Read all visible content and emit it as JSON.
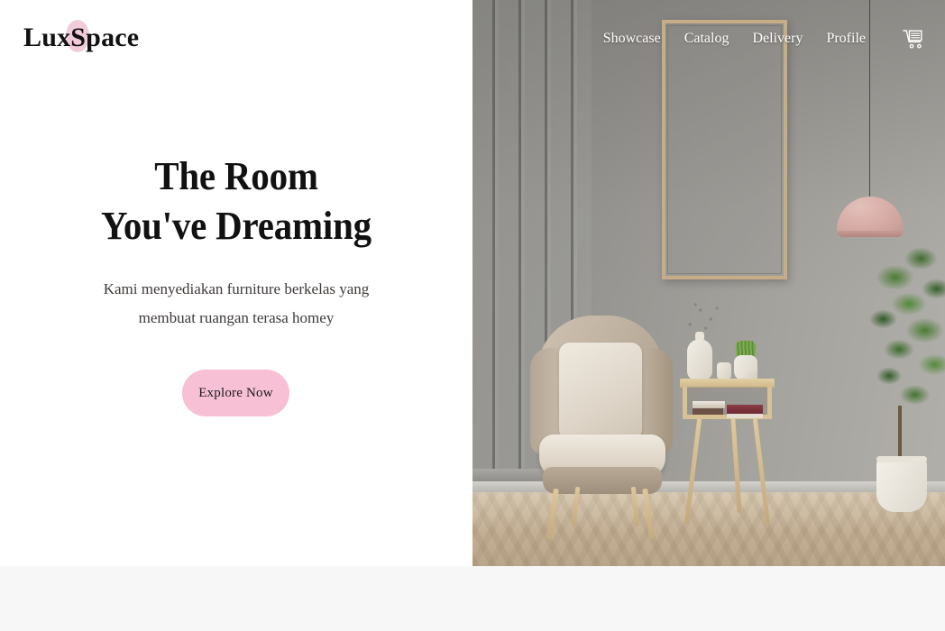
{
  "brand": {
    "name": "LuxSpace",
    "accent_pink": "#f2cbdb"
  },
  "nav": {
    "links": [
      {
        "label": "Showcase"
      },
      {
        "label": "Catalog"
      },
      {
        "label": "Delivery"
      },
      {
        "label": "Profile"
      }
    ],
    "cart_icon": "shopping-cart-icon"
  },
  "hero": {
    "headline_line1": "The Room",
    "headline_line2": "You've Dreaming",
    "subhead": "Kami menyediakan furniture berkelas yang membuat ruangan terasa homey",
    "cta_label": "Explore Now",
    "cta_color": "#f7c0d5",
    "play_button": {
      "icon": "play-icon",
      "color": "#b3e1ec"
    }
  },
  "photo": {
    "alt": "living room with beige wingback armchair, wooden side table and potted ficus tree",
    "wall_color": "#959490",
    "frame_color": "#c6ad87",
    "lamp_color": "#d6aaa4",
    "floor_color": "#c3b095"
  },
  "below_fold": {
    "background": "#f7f7f7"
  }
}
